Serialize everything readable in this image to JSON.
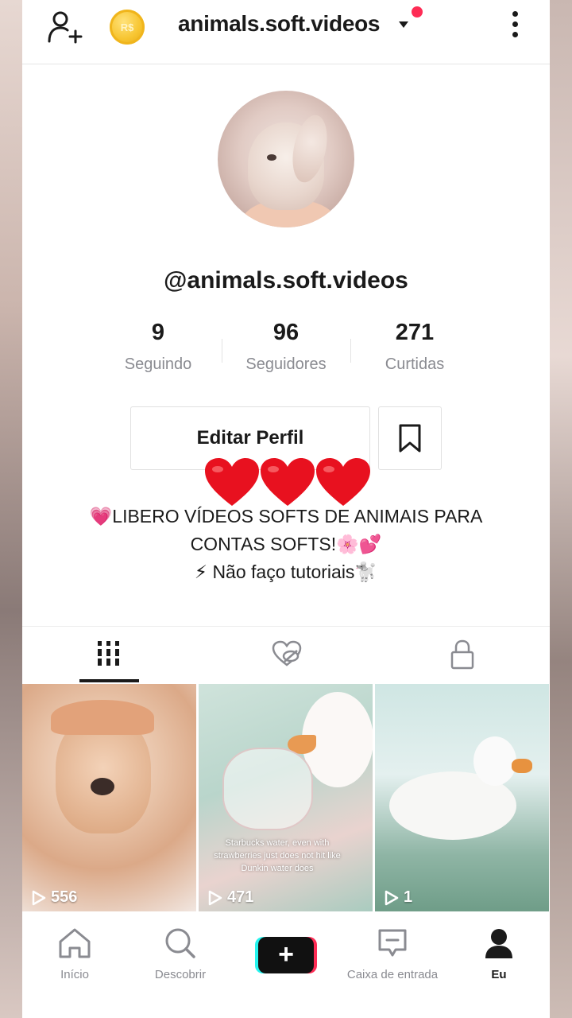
{
  "header": {
    "username": "animals.soft.videos",
    "coin_label": "R$"
  },
  "profile": {
    "handle": "@animals.soft.videos",
    "stats": [
      {
        "value": "9",
        "label": "Seguindo"
      },
      {
        "value": "96",
        "label": "Seguidores"
      },
      {
        "value": "271",
        "label": "Curtidas"
      }
    ],
    "edit_button": "Editar Perfil",
    "bio_lines": [
      "💗LIBERO VÍDEOS SOFTS DE ANIMAIS PARA",
      "CONTAS SOFTS!🌸💕",
      "⚡ Não faço tutoriais🐩"
    ]
  },
  "tabs": [
    {
      "icon": "grid-icon",
      "active": true
    },
    {
      "icon": "liked-hidden-icon",
      "active": false
    },
    {
      "icon": "lock-icon",
      "active": false
    }
  ],
  "videos": [
    {
      "views": "556"
    },
    {
      "views": "471",
      "caption": "Starbucks water, even with strawberries just does not hit like Dunkin water does"
    },
    {
      "views": "1"
    }
  ],
  "bottom_nav": [
    {
      "label": "Início",
      "icon": "home-icon"
    },
    {
      "label": "Descobrir",
      "icon": "search-icon"
    },
    {
      "label": "",
      "icon": "create-plus-icon"
    },
    {
      "label": "Caixa de entrada",
      "icon": "inbox-icon"
    },
    {
      "label": "Eu",
      "icon": "profile-icon",
      "active": true
    }
  ],
  "colors": {
    "accent": "#fe2c55",
    "cyan": "#25f4ee",
    "text": "#1a1a1a",
    "muted": "#8a8b91",
    "coin": "#f7c531"
  }
}
